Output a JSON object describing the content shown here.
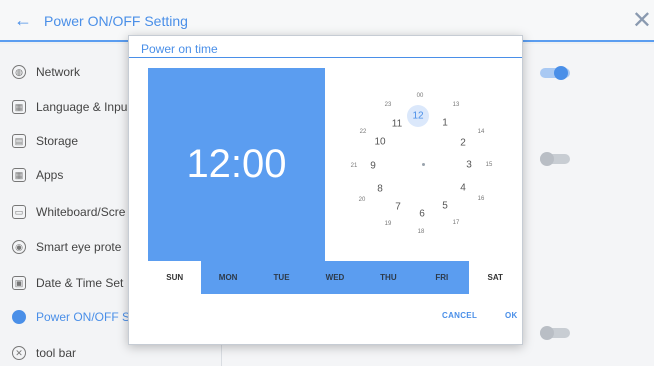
{
  "header": {
    "title": "Power ON/OFF Setting"
  },
  "sidebar": {
    "items": [
      {
        "label": "Network",
        "icon": "globe-icon"
      },
      {
        "label": "Language & Inpu",
        "icon": "keyboard-icon"
      },
      {
        "label": "Storage",
        "icon": "storage-icon"
      },
      {
        "label": "Apps",
        "icon": "apps-grid-icon"
      },
      {
        "label": "Whiteboard/Scre",
        "icon": "whiteboard-icon"
      },
      {
        "label": "Smart eye prote",
        "icon": "eye-icon"
      },
      {
        "label": "Date & Time Set",
        "icon": "calendar-icon"
      },
      {
        "label": "Power ON/OFF S",
        "icon": "power-icon"
      },
      {
        "label": "tool bar",
        "icon": "tool-icon"
      }
    ]
  },
  "dialog": {
    "title": "Power on time",
    "time": "12:00",
    "clock_outer": [
      "12",
      "1",
      "2",
      "3",
      "4",
      "5",
      "6",
      "7",
      "8",
      "9",
      "10",
      "11"
    ],
    "clock_inner": [
      "00",
      "13",
      "14",
      "15",
      "16",
      "17",
      "18",
      "19",
      "20",
      "21",
      "22",
      "23"
    ],
    "selected": "12",
    "days": [
      "SUN",
      "MON",
      "TUE",
      "WED",
      "THU",
      "FRI",
      "SAT"
    ],
    "cancel_label": "CANCEL",
    "ok_label": "OK"
  },
  "colors": {
    "accent": "#5b9df0",
    "accent_text": "#4a8fe8"
  }
}
